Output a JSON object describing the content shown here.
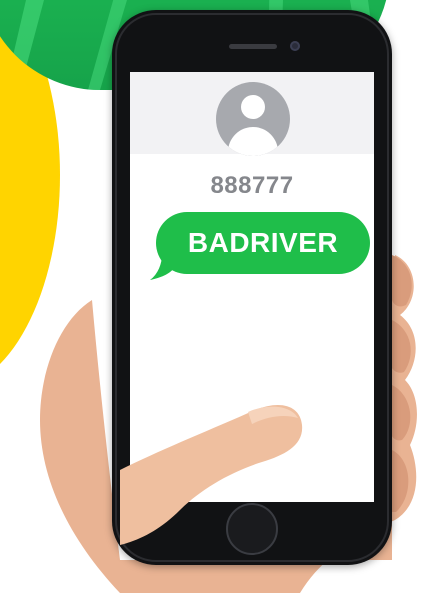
{
  "conversation": {
    "contact_number": "888777",
    "message_text": "BADRIVER"
  },
  "icons": {
    "avatar": "person-avatar-icon",
    "home": "home-button-icon",
    "speaker": "speaker-grille-icon",
    "camera": "front-camera-icon"
  },
  "colors": {
    "bubble": "#1fbe4a",
    "contact_text": "#85878c",
    "avatar": "#a7a9ae",
    "background_yellow": "#ffd400",
    "background_green": "#1db954"
  }
}
